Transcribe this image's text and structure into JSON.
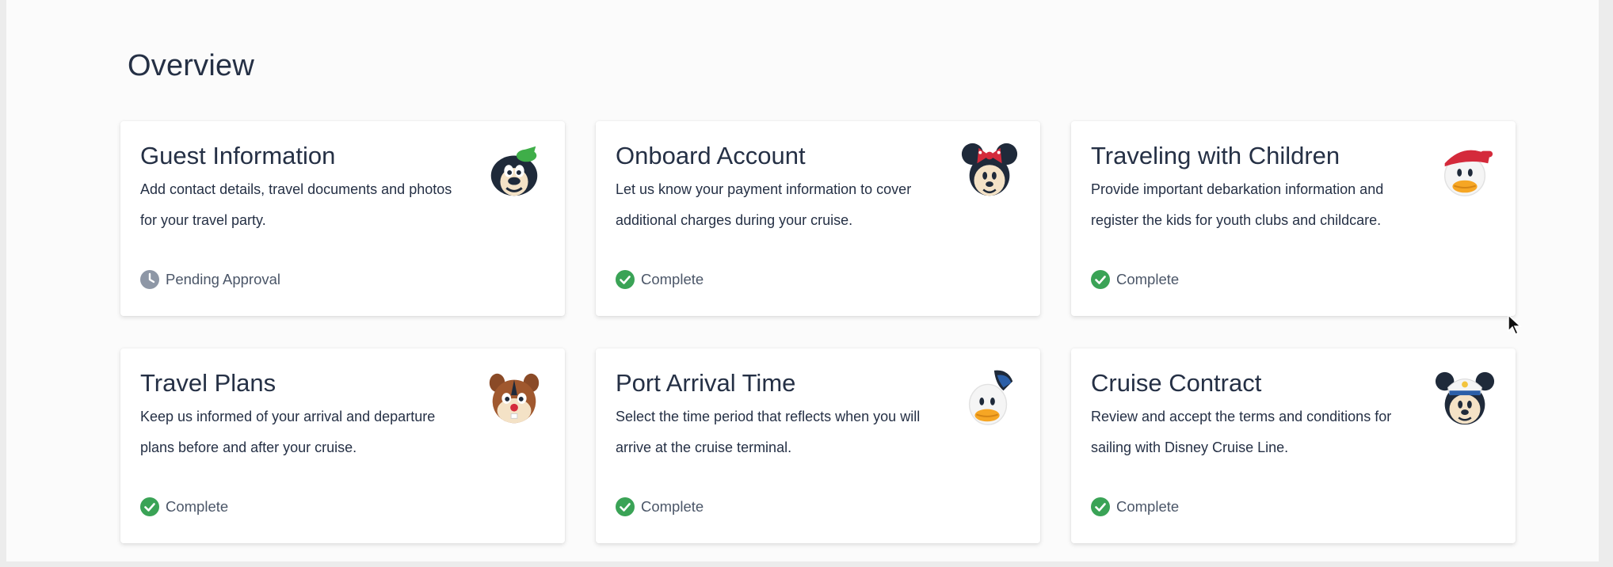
{
  "overview": {
    "title": "Overview"
  },
  "colors": {
    "complete": "#3aa356",
    "pending": "#8e97a6",
    "text": "#253045"
  },
  "cards": [
    {
      "title": "Guest Information",
      "description": "Add contact details, travel documents and photos for your travel party.",
      "status": "Pending Approval",
      "status_icon": "clock-icon",
      "avatar": "goofy-avatar-icon"
    },
    {
      "title": "Onboard Account",
      "description": "Let us know your payment information to cover additional charges during your cruise.",
      "status": "Complete",
      "status_icon": "check-circle-icon",
      "avatar": "minnie-avatar-icon"
    },
    {
      "title": "Traveling with Children",
      "description": "Provide important debarkation information and register the kids for youth clubs and childcare.",
      "status": "Complete",
      "status_icon": "check-circle-icon",
      "avatar": "duck-avatar-icon"
    },
    {
      "title": "Travel Plans",
      "description": "Keep us informed of your arrival and departure plans before and after your cruise.",
      "status": "Complete",
      "status_icon": "check-circle-icon",
      "avatar": "chipmunk-avatar-icon"
    },
    {
      "title": "Port Arrival Time",
      "description": "Select the time period that reflects when you will arrive at the cruise terminal.",
      "status": "Complete",
      "status_icon": "check-circle-icon",
      "avatar": "donald-avatar-icon"
    },
    {
      "title": "Cruise Contract",
      "description": "Review and accept the terms and conditions for sailing with Disney Cruise Line.",
      "status": "Complete",
      "status_icon": "check-circle-icon",
      "avatar": "captain-mickey-avatar-icon"
    }
  ]
}
